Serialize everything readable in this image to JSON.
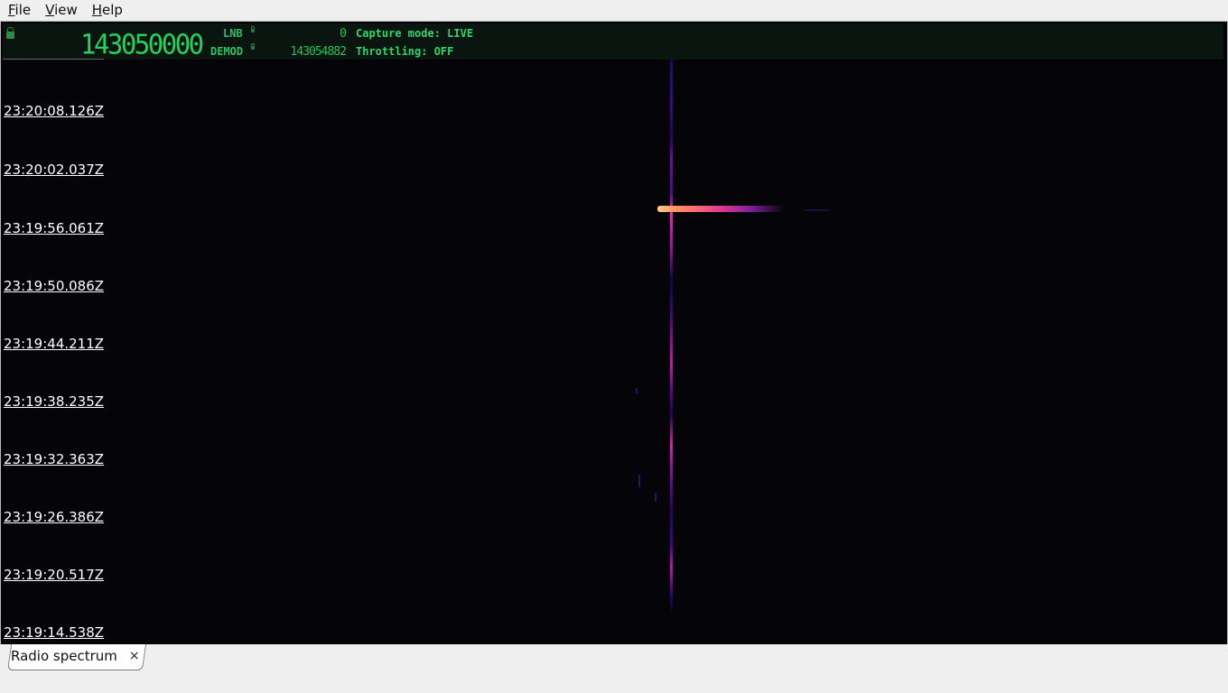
{
  "menu": [
    {
      "label": "File",
      "mnemonic": "F",
      "rest": "ile"
    },
    {
      "label": "View",
      "mnemonic": "V",
      "rest": "iew"
    },
    {
      "label": "Help",
      "mnemonic": "H",
      "rest": "elp"
    }
  ],
  "hud": {
    "frequency": "143050000",
    "lnb_label": "LNB",
    "lnb_value": "0",
    "demod_label": "DEMOD",
    "demod_value": "143054882",
    "capture_mode": "Capture mode: LIVE",
    "throttling": "Throttling: OFF",
    "display_color": "#27d05e"
  },
  "spectrum": {
    "timestamps": [
      "23:20:08.126Z",
      "23:20:02.037Z",
      "23:19:56.061Z",
      "23:19:50.086Z",
      "23:19:44.211Z",
      "23:19:38.235Z",
      "23:19:32.363Z",
      "23:19:26.386Z",
      "23:19:20.517Z",
      "23:19:14.538Z"
    ]
  },
  "tabs": [
    {
      "label": "Radio spectrum",
      "close": "×"
    }
  ]
}
